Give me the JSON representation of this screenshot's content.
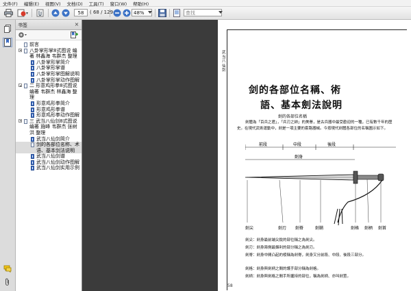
{
  "menubar": {
    "items": [
      "文件(F)",
      "编辑(E)",
      "视图(V)",
      "文档(D)",
      "工具(T)",
      "窗口(W)",
      "帮助(H)"
    ]
  },
  "toolbar": {
    "page_current": "58",
    "page_total": "( 68 / 129 )",
    "zoom": "48%",
    "search_placeholder": "查找"
  },
  "sidebar": {
    "title": "书签",
    "close_glyph": "×",
    "bookmarks": [
      {
        "label": "前言",
        "level": 0,
        "expandable": false
      },
      {
        "label": "八卦掌形掌8式图说 编著 林鑫海 韦群杰 整理",
        "level": 0,
        "expandable": true
      },
      {
        "label": "八卦掌形掌简介",
        "level": 1
      },
      {
        "label": "八卦掌形掌谱",
        "level": 1
      },
      {
        "label": "八卦掌形掌图解说明",
        "level": 1
      },
      {
        "label": "八卦掌形掌动作图解",
        "level": 1
      },
      {
        "label": "二 形意鸡形拳8式图说 编著 韦群杰 林鑫海 整理",
        "level": 0,
        "expandable": true
      },
      {
        "label": "形意鸡形拳简介",
        "level": 1
      },
      {
        "label": "形意鸡形拳谱",
        "level": 1
      },
      {
        "label": "形意鸡形拳动作图解",
        "level": 1
      },
      {
        "label": "三 武当八仙剑8式图说 编著 施峰 韦群杰 张树洪 整理",
        "level": 0,
        "expandable": true
      },
      {
        "label": "武当八仙剑简介",
        "level": 1
      },
      {
        "label": "剑的各部位名称、术语、基本剑法说明",
        "level": 1,
        "selected": true
      },
      {
        "label": "武当八仙剑谱",
        "level": 1
      },
      {
        "label": "武当八仙剑动作图解",
        "level": 1
      },
      {
        "label": "武当八仙剑实用示例",
        "level": 1
      }
    ]
  },
  "page": {
    "running_head": "武当八仙剑",
    "title_line1": "剑的各部位名稱、術",
    "title_line2": "語、基本劍法說明",
    "subhead": "劍的各部位名稱",
    "paragraphs": [
      "劍體為「百兵之君」，「兵刃之帥」的美譽，是古兵器中最受歡迎的一種，已有數千年的歷史。在現代武術運動中，劍是一項主要的套路器械。今按現代劍體各部位的名稱圖示如下。",
      "劍尖：劍身最前端尖銳的部位稱之為劍尖。",
      "劍刃：劍身兩側最鋒利的部分稱之為劍刃。",
      "劍脊：劍身中間凸起的棱稱為劍脊，劍身又分前段、中段、後段三部分。",
      "劍格：劍身與劍柄之間的護手部分稱為劍格。",
      "劍柄：劍身與劍格之間手所握持的部位，稱為劍柄、亦叫劍莖。"
    ],
    "diagram_labels": {
      "front": "前段",
      "middle": "中段",
      "back": "後段",
      "body": "劍身",
      "parts": [
        "劍尖",
        "劍刃",
        "劍脊",
        "劍格",
        "劍柄",
        "劍首",
        "劍穗",
        "劍鞘"
      ]
    },
    "page_number": "58"
  }
}
